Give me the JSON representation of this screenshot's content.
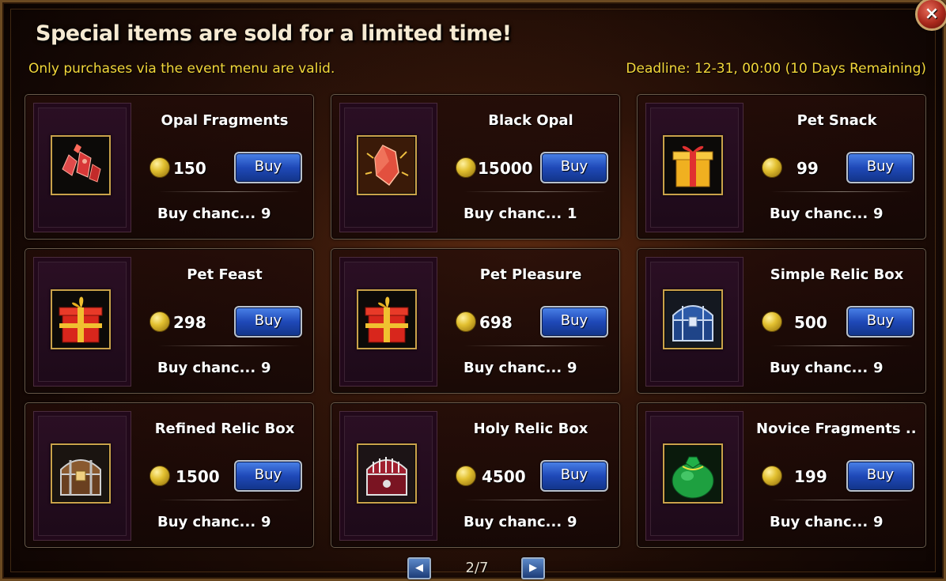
{
  "header": {
    "title": "Special items are sold for a limited time!",
    "subtitle": "Only purchases via the event menu are valid.",
    "deadline": "Deadline: 12-31, 00:00 (10 Days Remaining)"
  },
  "close_label": "×",
  "buy_label": "Buy",
  "chance_label": "Buy chanc...",
  "items": [
    {
      "name": "Opal Fragments",
      "price": "150",
      "chance": "9",
      "icon": "opal-fragments-icon"
    },
    {
      "name": "Black Opal",
      "price": "15000",
      "chance": "1",
      "icon": "black-opal-icon"
    },
    {
      "name": "Pet Snack",
      "price": "99",
      "chance": "9",
      "icon": "pet-snack-gift-icon"
    },
    {
      "name": "Pet Feast",
      "price": "298",
      "chance": "9",
      "icon": "pet-feast-gift-icon"
    },
    {
      "name": "Pet Pleasure",
      "price": "698",
      "chance": "9",
      "icon": "pet-pleasure-gift-icon"
    },
    {
      "name": "Simple Relic Box",
      "price": "500",
      "chance": "9",
      "icon": "simple-relic-box-icon"
    },
    {
      "name": "Refined Relic Box",
      "price": "1500",
      "chance": "9",
      "icon": "refined-relic-box-icon"
    },
    {
      "name": "Holy Relic Box",
      "price": "4500",
      "chance": "9",
      "icon": "holy-relic-box-icon"
    },
    {
      "name": "Novice Fragments ...",
      "price": "199",
      "chance": "9",
      "icon": "novice-fragments-bag-icon"
    }
  ],
  "pagination": {
    "page": "2/7",
    "prev_icon": "◀",
    "next_icon": "▶"
  }
}
